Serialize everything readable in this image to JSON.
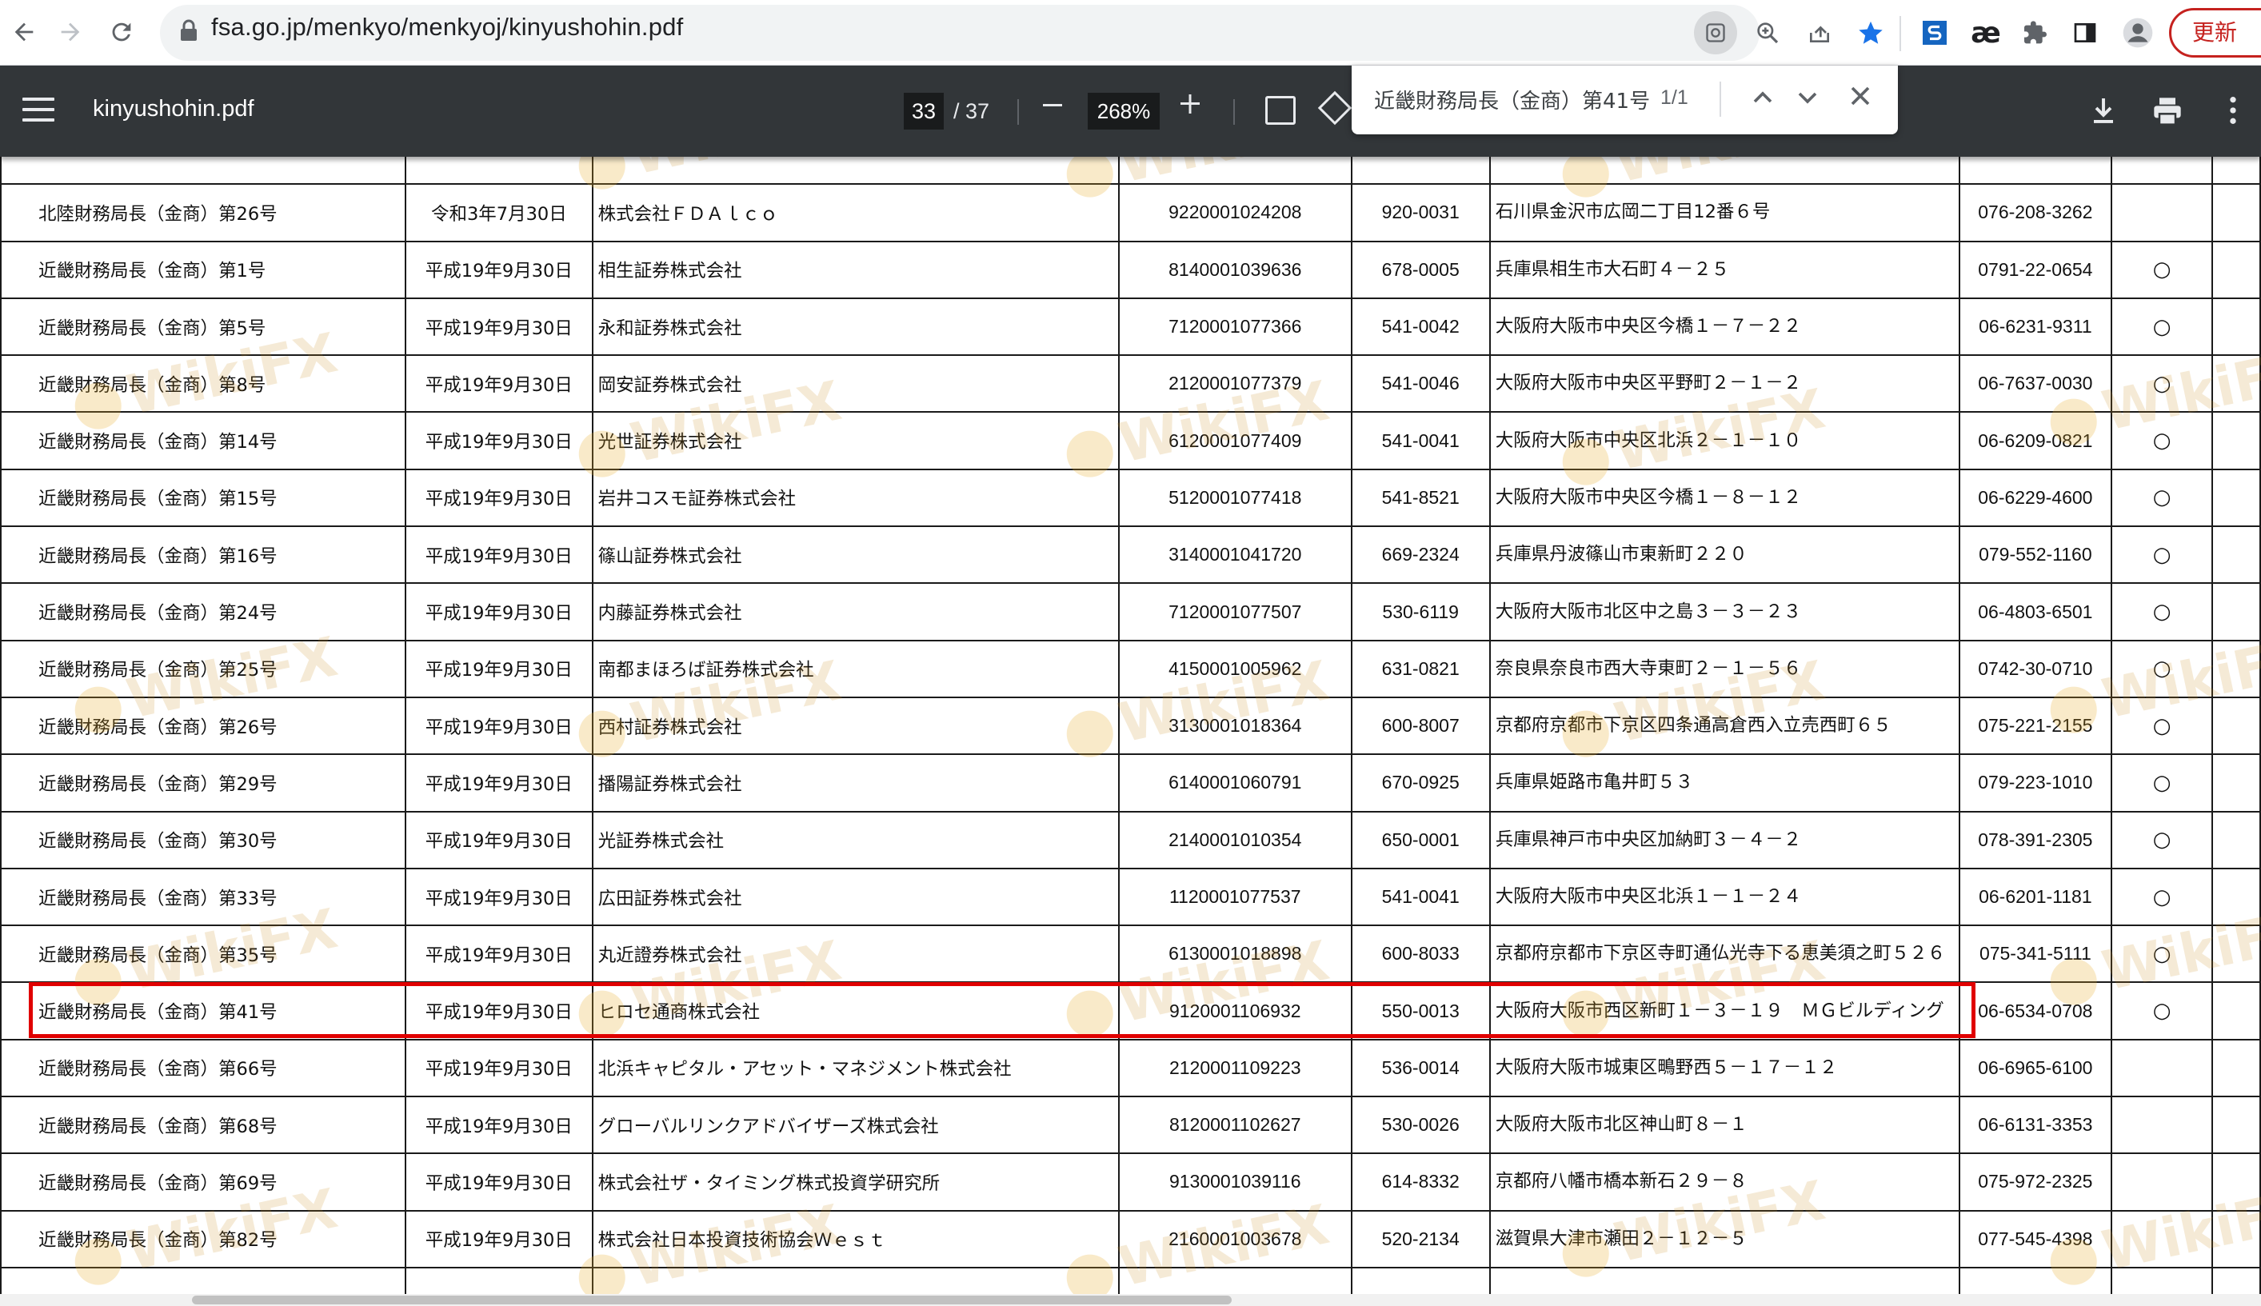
{
  "browser": {
    "url": "fsa.go.jp/menkyo/menkyoj/kinyushohin.pdf",
    "update_label": "更新"
  },
  "pdf_toolbar": {
    "filename": "kinyushohin.pdf",
    "current_page": "33",
    "total_pages": "/ 37",
    "zoom": "268%"
  },
  "find_bar": {
    "query": "近畿財務局長（金商）第41号",
    "count": "1/1"
  },
  "watermark_text": "WikiFX",
  "table": {
    "rows": [
      {
        "authority": "北陸財務局長（金商）第26号",
        "date": "令和3年7月30日",
        "name": "株式会社ＦＤＡｌｃｏ",
        "corp_no": "9220001024208",
        "zip": "920-0031",
        "address": "石川県金沢市広岡二丁目12番６号",
        "tel": "076-208-3262",
        "mark": ""
      },
      {
        "authority": "近畿財務局長（金商）第1号",
        "date": "平成19年9月30日",
        "name": "相生証券株式会社",
        "corp_no": "8140001039636",
        "zip": "678-0005",
        "address": "兵庫県相生市大石町４－２５",
        "tel": "0791-22-0654",
        "mark": "○"
      },
      {
        "authority": "近畿財務局長（金商）第5号",
        "date": "平成19年9月30日",
        "name": "永和証券株式会社",
        "corp_no": "7120001077366",
        "zip": "541-0042",
        "address": "大阪府大阪市中央区今橋１－７－２２",
        "tel": "06-6231-9311",
        "mark": "○"
      },
      {
        "authority": "近畿財務局長（金商）第8号",
        "date": "平成19年9月30日",
        "name": "岡安証券株式会社",
        "corp_no": "2120001077379",
        "zip": "541-0046",
        "address": "大阪府大阪市中央区平野町２－１－２",
        "tel": "06-7637-0030",
        "mark": "○"
      },
      {
        "authority": "近畿財務局長（金商）第14号",
        "date": "平成19年9月30日",
        "name": "光世証券株式会社",
        "corp_no": "6120001077409",
        "zip": "541-0041",
        "address": "大阪府大阪市中央区北浜２－１－１０",
        "tel": "06-6209-0821",
        "mark": "○"
      },
      {
        "authority": "近畿財務局長（金商）第15号",
        "date": "平成19年9月30日",
        "name": "岩井コスモ証券株式会社",
        "corp_no": "5120001077418",
        "zip": "541-8521",
        "address": "大阪府大阪市中央区今橋１－８－１２",
        "tel": "06-6229-4600",
        "mark": "○"
      },
      {
        "authority": "近畿財務局長（金商）第16号",
        "date": "平成19年9月30日",
        "name": "篠山証券株式会社",
        "corp_no": "3140001041720",
        "zip": "669-2324",
        "address": "兵庫県丹波篠山市東新町２２０",
        "tel": "079-552-1160",
        "mark": "○"
      },
      {
        "authority": "近畿財務局長（金商）第24号",
        "date": "平成19年9月30日",
        "name": "内藤証券株式会社",
        "corp_no": "7120001077507",
        "zip": "530-6119",
        "address": "大阪府大阪市北区中之島３－３－２３",
        "tel": "06-4803-6501",
        "mark": "○"
      },
      {
        "authority": "近畿財務局長（金商）第25号",
        "date": "平成19年9月30日",
        "name": "南都まほろば証券株式会社",
        "corp_no": "4150001005962",
        "zip": "631-0821",
        "address": "奈良県奈良市西大寺東町２－１－５６",
        "tel": "0742-30-0710",
        "mark": "○"
      },
      {
        "authority": "近畿財務局長（金商）第26号",
        "date": "平成19年9月30日",
        "name": "西村証券株式会社",
        "corp_no": "3130001018364",
        "zip": "600-8007",
        "address": "京都府京都市下京区四条通高倉西入立売西町６５",
        "tel": "075-221-2155",
        "mark": "○"
      },
      {
        "authority": "近畿財務局長（金商）第29号",
        "date": "平成19年9月30日",
        "name": "播陽証券株式会社",
        "corp_no": "6140001060791",
        "zip": "670-0925",
        "address": "兵庫県姫路市亀井町５３",
        "tel": "079-223-1010",
        "mark": "○"
      },
      {
        "authority": "近畿財務局長（金商）第30号",
        "date": "平成19年9月30日",
        "name": "光証券株式会社",
        "corp_no": "2140001010354",
        "zip": "650-0001",
        "address": "兵庫県神戸市中央区加納町３－４－２",
        "tel": "078-391-2305",
        "mark": "○"
      },
      {
        "authority": "近畿財務局長（金商）第33号",
        "date": "平成19年9月30日",
        "name": "広田証券株式会社",
        "corp_no": "1120001077537",
        "zip": "541-0041",
        "address": "大阪府大阪市中央区北浜１－１－２４",
        "tel": "06-6201-1181",
        "mark": "○"
      },
      {
        "authority": "近畿財務局長（金商）第35号",
        "date": "平成19年9月30日",
        "name": "丸近證券株式会社",
        "corp_no": "6130001018898",
        "zip": "600-8033",
        "address": "京都府京都市下京区寺町通仏光寺下る恵美須之町５２６",
        "tel": "075-341-5111",
        "mark": "○"
      },
      {
        "authority": "近畿財務局長（金商）第41号",
        "date": "平成19年9月30日",
        "name": "ヒロセ通商株式会社",
        "corp_no": "9120001106932",
        "zip": "550-0013",
        "address": "大阪府大阪市西区新町１－３－１９　ＭＧビルディング",
        "tel": "06-6534-0708",
        "mark": "○"
      },
      {
        "authority": "近畿財務局長（金商）第66号",
        "date": "平成19年9月30日",
        "name": "北浜キャピタル・アセット・マネジメント株式会社",
        "corp_no": "2120001109223",
        "zip": "536-0014",
        "address": "大阪府大阪市城東区鴫野西５－１７－１２",
        "tel": "06-6965-6100",
        "mark": ""
      },
      {
        "authority": "近畿財務局長（金商）第68号",
        "date": "平成19年9月30日",
        "name": "グローバルリンクアドバイザーズ株式会社",
        "corp_no": "8120001102627",
        "zip": "530-0026",
        "address": "大阪府大阪市北区神山町８－１",
        "tel": "06-6131-3353",
        "mark": ""
      },
      {
        "authority": "近畿財務局長（金商）第69号",
        "date": "平成19年9月30日",
        "name": "株式会社ザ・タイミング株式投資学研究所",
        "corp_no": "9130001039116",
        "zip": "614-8332",
        "address": "京都府八幡市橋本新石２９－８",
        "tel": "075-972-2325",
        "mark": ""
      },
      {
        "authority": "近畿財務局長（金商）第82号",
        "date": "平成19年9月30日",
        "name": "株式会社日本投資技術協会Ｗｅｓｔ",
        "corp_no": "2160001003678",
        "zip": "520-2134",
        "address": "滋賀県大津市瀬田２－１２－５",
        "tel": "077-545-4398",
        "mark": ""
      }
    ]
  }
}
